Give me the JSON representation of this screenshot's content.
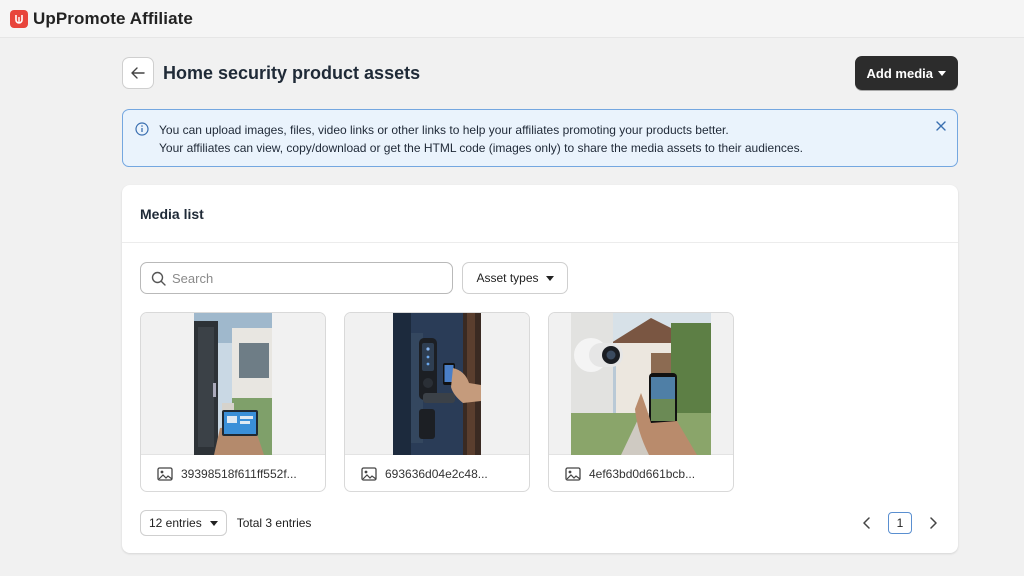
{
  "app": {
    "title": "UpPromote Affiliate",
    "brand_color": "#e8453c"
  },
  "header": {
    "title": "Home security product assets",
    "add_media_label": "Add media"
  },
  "banner": {
    "line1": "You can upload images, files, video links or other links to help your affiliates promoting your products better.",
    "line2": "Your affiliates can view, copy/download or get the HTML code (images only) to share the media assets to their audiences."
  },
  "media_list": {
    "title": "Media list",
    "search_placeholder": "Search",
    "asset_types_label": "Asset types",
    "items": [
      {
        "name": "39398518f611ff552f...",
        "icon": "image-icon"
      },
      {
        "name": "693636d04e2c48...",
        "icon": "image-icon"
      },
      {
        "name": "4ef63bd0d661bcb...",
        "icon": "image-icon"
      }
    ]
  },
  "footer": {
    "entries_label": "12 entries",
    "total_label": "Total 3 entries",
    "current_page": "1"
  }
}
